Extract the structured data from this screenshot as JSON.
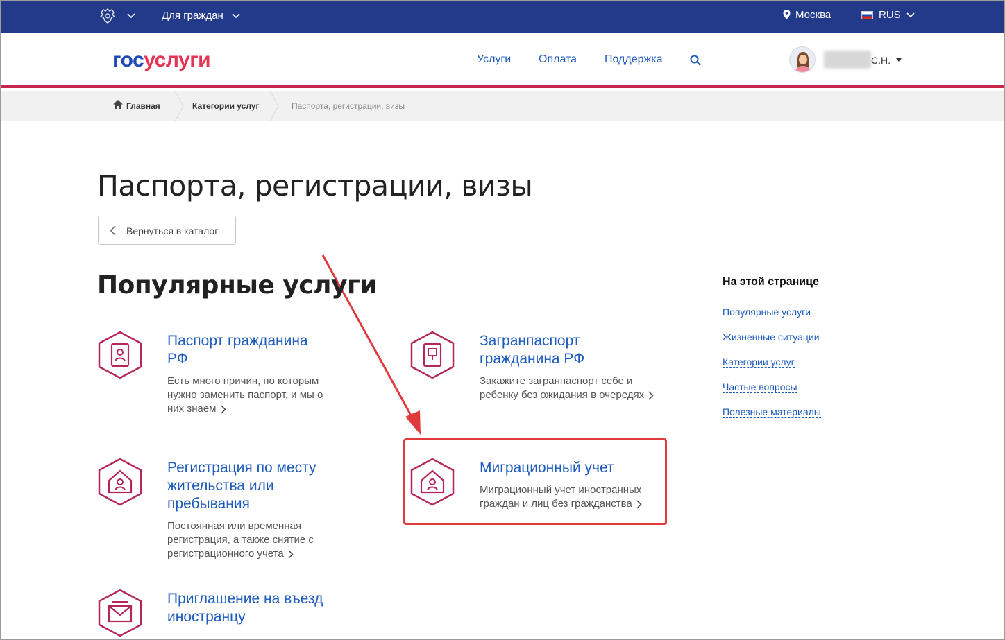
{
  "topbar": {
    "audience": "Для граждан",
    "city": "Москва",
    "language": "RUS",
    "emblem_icon": "coat-of-arms-icon"
  },
  "header": {
    "logo_part1": "гос",
    "logo_part2": "услуги",
    "nav": [
      "Услуги",
      "Оплата",
      "Поддержка"
    ],
    "user_initials": "С.Н."
  },
  "breadcrumb": [
    "Главная",
    "Категории услуг",
    "Паспорта, регистрации, визы"
  ],
  "page": {
    "title": "Паспорта, регистрации, визы",
    "back_button": "Вернуться в каталог",
    "section_title": "Популярные услуги"
  },
  "services": [
    {
      "title_line1": "Паспорт гражданина",
      "title_line2": "РФ",
      "desc_line1": "Есть много причин, по которым",
      "desc_line2": "нужно заменить паспорт, и мы о",
      "desc_line3": "них знаем",
      "icon": "passport-icon"
    },
    {
      "title_line1": "Загранпаспорт",
      "title_line2": "гражданина РФ",
      "desc_line1": "Закажите загранпаспорт себе и",
      "desc_line2": "ребенку без ожидания в очередях",
      "icon": "foreign-passport-icon"
    },
    {
      "title_line1": "Регистрация по месту",
      "title_line2": "жительства или",
      "title_line3": "пребывания",
      "desc_line1": "Постоянная или временная",
      "desc_line2": "регистрация, а также снятие с",
      "desc_line3": "регистрационного учета",
      "icon": "house-person-icon"
    },
    {
      "title_line1": "Миграционный учет",
      "desc_line1": "Миграционный учет иностранных",
      "desc_line2": "граждан и лиц без гражданства",
      "icon": "house-person-icon"
    },
    {
      "title_line1": "Приглашение на въезд",
      "title_line2": "иностранцу",
      "icon": "envelope-icon"
    }
  ],
  "sidebar": {
    "title": "На этой странице",
    "links": [
      "Популярные услуги",
      "Жизненные ситуации",
      "Категории услуг",
      "Частые вопросы",
      "Полезные материалы"
    ]
  },
  "colors": {
    "topbar": "#233a8a",
    "accent": "#c9254f",
    "link": "#1d5bbd",
    "annotation": "#e0393e"
  }
}
